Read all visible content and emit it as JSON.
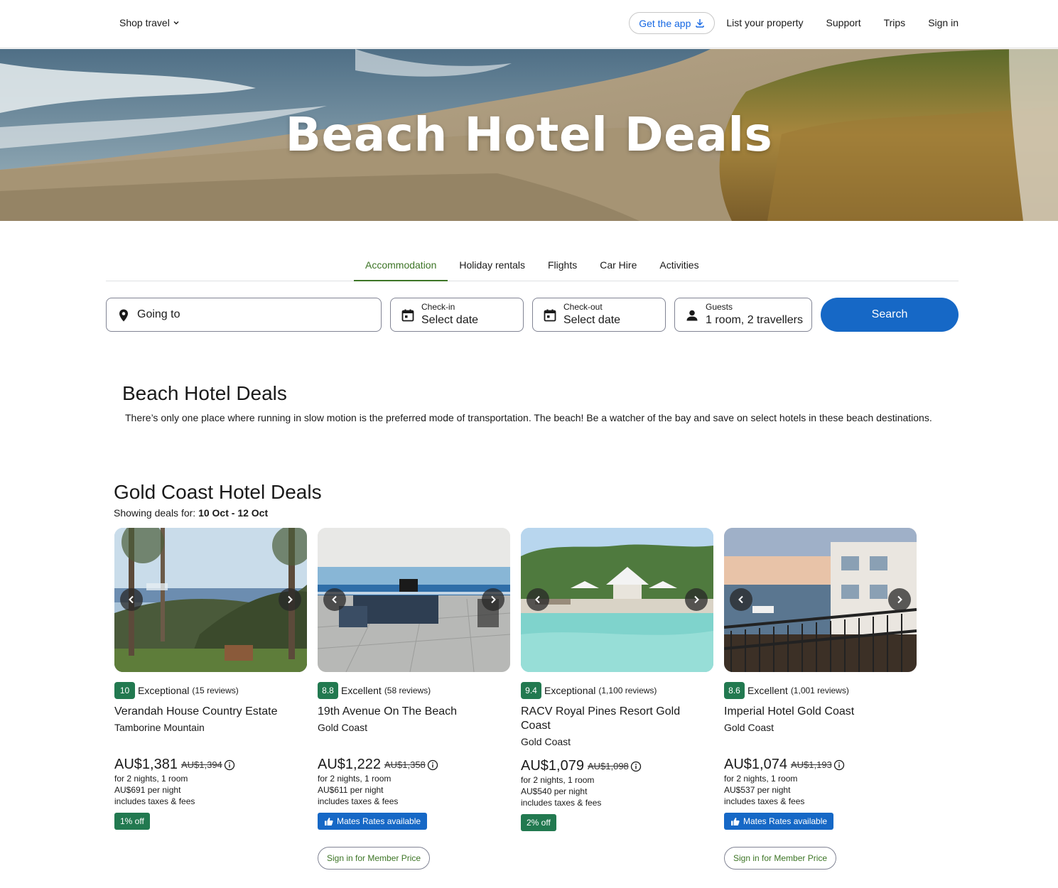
{
  "header": {
    "shop_travel": "Shop travel",
    "get_app": "Get the app",
    "nav": [
      "List your property",
      "Support",
      "Trips",
      "Sign in"
    ]
  },
  "hero": {
    "title": "Beach Hotel Deals"
  },
  "tabs": [
    {
      "label": "Accommodation",
      "active": true
    },
    {
      "label": "Holiday rentals"
    },
    {
      "label": "Flights"
    },
    {
      "label": "Car Hire"
    },
    {
      "label": "Activities"
    }
  ],
  "search": {
    "destination_placeholder": "Going to",
    "checkin_label": "Check-in",
    "checkin_value": "Select date",
    "checkout_label": "Check-out",
    "checkout_value": "Select date",
    "guests_label": "Guests",
    "guests_value": "1 room, 2 travellers",
    "button": "Search"
  },
  "intro": {
    "title": "Beach Hotel Deals",
    "text": "There’s only one place where running in slow motion is the preferred mode of transportation. The beach! Be a watcher of the bay and save on select hotels in these beach destinations."
  },
  "deals": {
    "title": "Gold Coast Hotel Deals",
    "showing_prefix": "Showing deals for: ",
    "dates": "10 Oct - 12 Oct",
    "cards": [
      {
        "score": "10",
        "rating": "Exceptional",
        "reviews": "(15 reviews)",
        "name": "Verandah House Country Estate",
        "location": "Tamborine Mountain",
        "price": "AU$1,381",
        "old_price": "AU$1,394",
        "nights": "for 2 nights, 1 room",
        "per_night": "AU$691 per night",
        "taxes": "includes taxes & fees",
        "badge": "1% off"
      },
      {
        "score": "8.8",
        "rating": "Excellent",
        "reviews": "(58 reviews)",
        "name": "19th Avenue On The Beach",
        "location": "Gold Coast",
        "price": "AU$1,222",
        "old_price": "AU$1,358",
        "nights": "for 2 nights, 1 room",
        "per_night": "AU$611 per night",
        "taxes": "includes taxes & fees",
        "mates": "Mates Rates available",
        "member": "Sign in for Member Price"
      },
      {
        "score": "9.4",
        "rating": "Exceptional",
        "reviews": "(1,100 reviews)",
        "name": "RACV Royal Pines Resort Gold Coast",
        "location": "Gold Coast",
        "price": "AU$1,079",
        "old_price": "AU$1,098",
        "nights": "for 2 nights, 1 room",
        "per_night": "AU$540 per night",
        "taxes": "includes taxes & fees",
        "badge": "2% off"
      },
      {
        "score": "8.6",
        "rating": "Excellent",
        "reviews": "(1,001 reviews)",
        "name": "Imperial Hotel Gold Coast",
        "location": "Gold Coast",
        "price": "AU$1,074",
        "old_price": "AU$1,193",
        "nights": "for 2 nights, 1 room",
        "per_night": "AU$537 per night",
        "taxes": "includes taxes & fees",
        "mates": "Mates Rates available",
        "member": "Sign in for Member Price"
      }
    ]
  },
  "colors": {
    "primary_blue": "#1668c6",
    "green_accent": "#3d7526",
    "rating_green": "#227950"
  }
}
